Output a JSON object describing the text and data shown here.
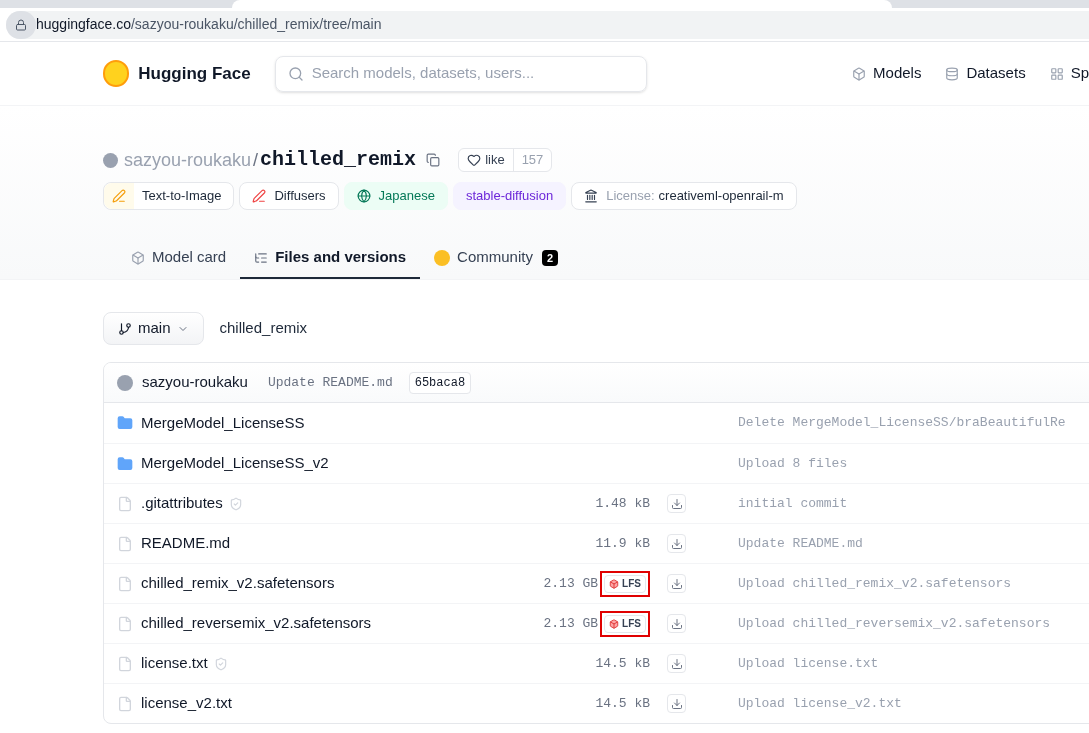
{
  "address_bar": {
    "host": "huggingface.co",
    "path": "/sazyou-roukaku/chilled_remix/tree/main"
  },
  "nav": {
    "brand": "Hugging Face",
    "search": {
      "placeholder": "Search models, datasets, users..."
    },
    "links": [
      {
        "label": "Models",
        "kind": "models"
      },
      {
        "label": "Datasets",
        "kind": "datasets"
      },
      {
        "label": "Sp",
        "kind": "spaces"
      }
    ]
  },
  "repo": {
    "owner": "sazyou-roukaku",
    "separator": "/",
    "name": "chilled_remix",
    "like_label": "like",
    "like_count": "157"
  },
  "tags": [
    {
      "kind": "task",
      "label": "Text-to-Image"
    },
    {
      "kind": "library",
      "label": "Diffusers"
    },
    {
      "kind": "language",
      "label": "Japanese"
    },
    {
      "kind": "other",
      "label": "stable-diffusion"
    },
    {
      "kind": "license",
      "prefix": "License:",
      "label": "creativeml-openrail-m"
    }
  ],
  "tabs": [
    {
      "kind": "model",
      "label": "Model card",
      "selected": false
    },
    {
      "kind": "files",
      "label": "Files and versions",
      "selected": true
    },
    {
      "kind": "community",
      "label": "Community",
      "badge": "2",
      "selected": false
    }
  ],
  "branch": {
    "name": "main",
    "path": "chilled_remix"
  },
  "last_commit": {
    "author": "sazyou-roukaku",
    "message": "Update README.md",
    "hash": "65baca8"
  },
  "files": [
    {
      "kind": "folder",
      "name": "MergeModel_LicenseSS",
      "commit": "Delete MergeModel_LicenseSS/braBeautifulRe"
    },
    {
      "kind": "folder",
      "name": "MergeModel_LicenseSS_v2",
      "commit": "Upload 8 files"
    },
    {
      "kind": "file",
      "name": ".gitattributes",
      "safe": true,
      "size": "1.48 kB",
      "lfs": false,
      "highlighted": false,
      "commit": "initial commit"
    },
    {
      "kind": "file",
      "name": "README.md",
      "safe": false,
      "size": "11.9 kB",
      "lfs": false,
      "highlighted": false,
      "commit": "Update README.md"
    },
    {
      "kind": "file",
      "name": "chilled_remix_v2.safetensors",
      "safe": false,
      "size": "2.13 GB",
      "lfs": true,
      "lfs_label": "LFS",
      "highlighted": true,
      "commit": "Upload chilled_remix_v2.safetensors"
    },
    {
      "kind": "file",
      "name": "chilled_reversemix_v2.safetensors",
      "safe": false,
      "size": "2.13 GB",
      "lfs": true,
      "lfs_label": "LFS",
      "highlighted": true,
      "commit": "Upload chilled_reversemix_v2.safetensors"
    },
    {
      "kind": "file",
      "name": "license.txt",
      "safe": true,
      "size": "14.5 kB",
      "lfs": false,
      "highlighted": false,
      "commit": "Upload license.txt"
    },
    {
      "kind": "file",
      "name": "license_v2.txt",
      "safe": false,
      "size": "14.5 kB",
      "lfs": false,
      "highlighted": false,
      "commit": "Upload license_v2.txt"
    }
  ]
}
